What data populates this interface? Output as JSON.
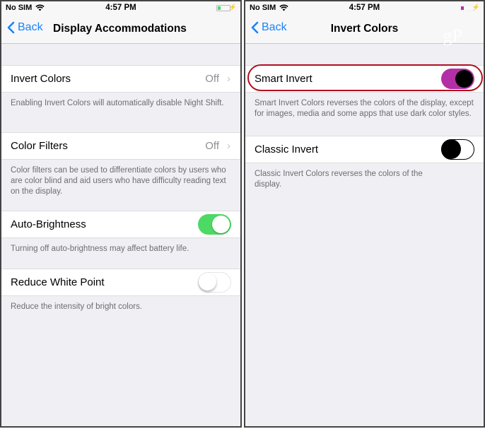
{
  "left": {
    "status": {
      "carrier": "No SIM",
      "time": "4:57 PM",
      "battery_color": "#4cd964"
    },
    "nav": {
      "back": "Back",
      "title": "Display Accommodations"
    },
    "rows": [
      {
        "label": "Invert Colors",
        "value": "Off",
        "footer": "Enabling Invert Colors will automatically disable Night Shift."
      },
      {
        "label": "Color Filters",
        "value": "Off",
        "footer": "Color filters can be used to differentiate colors by users who are color blind and aid users who have difficulty reading text on the display."
      },
      {
        "label": "Auto-Brightness",
        "toggle": "on",
        "footer": "Turning off auto-brightness may affect battery life."
      },
      {
        "label": "Reduce White Point",
        "toggle": "off",
        "footer": "Reduce the intensity of bright colors."
      }
    ]
  },
  "right": {
    "status": {
      "carrier": "No SIM",
      "time": "4:57 PM",
      "battery_color": "#b32fa5"
    },
    "nav": {
      "back": "Back",
      "title": "Invert Colors"
    },
    "watermark": "gP",
    "rows": [
      {
        "label": "Smart Invert",
        "toggle": "on",
        "footer": "Smart Invert Colors reverses the colors of the display, except for images, media and some apps that use dark color styles."
      },
      {
        "label": "Classic Invert",
        "toggle": "off",
        "footer": "Classic Invert Colors reverses the colors of the display."
      }
    ]
  },
  "colors": {
    "accent": "#1a82fb",
    "highlight_ring": "#b01020",
    "toggle_green": "#4cd964",
    "toggle_magenta": "#b32fa5"
  }
}
